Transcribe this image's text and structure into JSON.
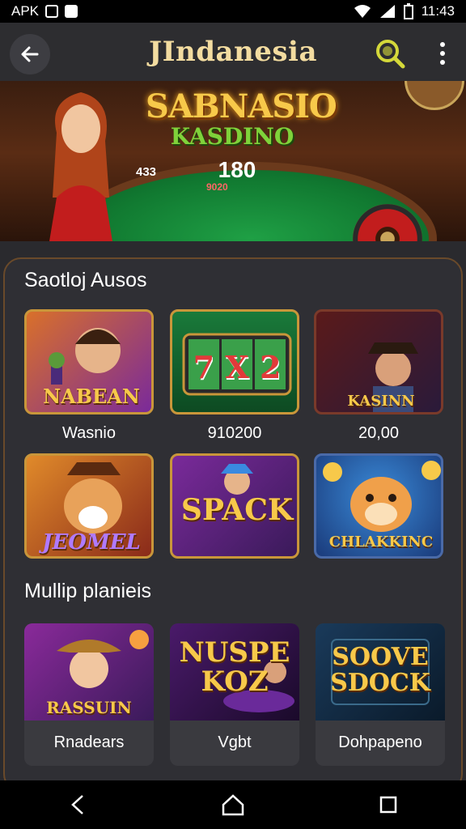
{
  "status_bar": {
    "left_text": "APK",
    "time": "11:43"
  },
  "app_bar": {
    "title": "JIndanesia",
    "back_icon": "arrow-left-icon",
    "search_icon": "search-icon",
    "more_icon": "more-vertical-icon",
    "accent_color": "#d4d83a"
  },
  "banner": {
    "title": "SABNASIO",
    "subtitle": "KASDINO",
    "table_main": "180",
    "table_left": "433",
    "table_sub": "9020"
  },
  "section1": {
    "title": "Saotloj Ausos",
    "tiles": [
      {
        "art_text": "NABEAN",
        "caption": "Wasnio",
        "art_icon": "man-with-microphone-icon"
      },
      {
        "art_text": "7 X 2",
        "caption": "910200",
        "art_icon": "slot-reels-icon"
      },
      {
        "art_text": "KASINN",
        "caption": "20,00",
        "art_icon": "dealer-man-icon"
      },
      {
        "art_text": "JEOMEL",
        "caption": "",
        "art_icon": "fox-mascot-icon"
      },
      {
        "art_text": "SPACK",
        "caption": "",
        "art_icon": "character-icon"
      },
      {
        "art_text": "CHLAKKINC",
        "caption": "",
        "art_icon": "hamster-mascot-icon"
      }
    ]
  },
  "section2": {
    "title": "Mullip planieis",
    "cards": [
      {
        "art_text": "RASSUIN",
        "caption": "Rnadears",
        "art_icon": "cowgirl-icon"
      },
      {
        "art_text": "NUSPE KOZ",
        "caption": "Vgbt",
        "art_icon": "casino-table-icon"
      },
      {
        "art_text": "SOOVE SDOCK",
        "caption": "Dohpapeno",
        "art_icon": "neon-sign-icon"
      }
    ]
  },
  "nav_bar": {
    "back_icon": "nav-back-icon",
    "home_icon": "nav-home-icon",
    "recents_icon": "nav-recents-icon"
  }
}
